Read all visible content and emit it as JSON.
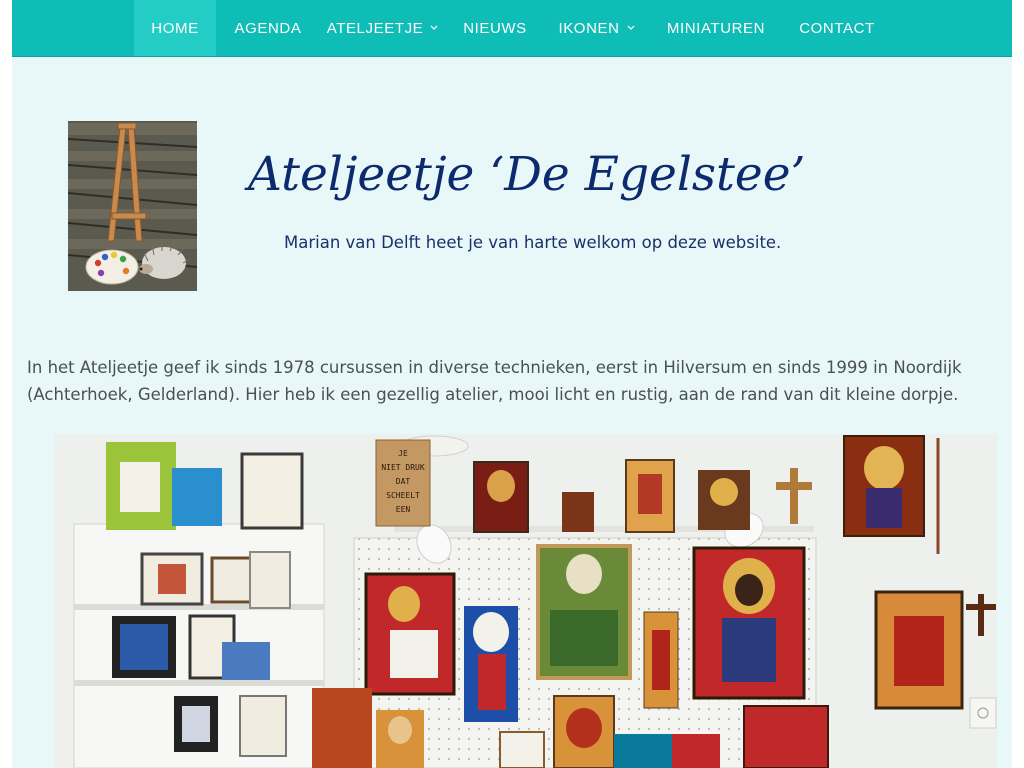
{
  "nav": {
    "items": [
      {
        "label": "HOME",
        "active": true,
        "has_dropdown": false
      },
      {
        "label": "AGENDA",
        "active": false,
        "has_dropdown": false
      },
      {
        "label": "ATELJEETJE",
        "active": false,
        "has_dropdown": true
      },
      {
        "label": "NIEUWS",
        "active": false,
        "has_dropdown": false
      },
      {
        "label": "IKONEN",
        "active": false,
        "has_dropdown": true
      },
      {
        "label": "MINIATUREN",
        "active": false,
        "has_dropdown": false
      },
      {
        "label": "CONTACT",
        "active": false,
        "has_dropdown": false
      }
    ]
  },
  "header": {
    "title": "Ateljeetje  ‘De Egelstee’",
    "tagline": "Marian van Delft heet je van harte welkom op deze website."
  },
  "intro": {
    "text": "In het Ateljeetje geef ik sinds 1978 cursussen in diverse technieken, eerst in Hilversum en sinds 1999 in Noordijk (Achterhoek, Gelderland). Hier heb ik een gezellig atelier, mooi licht en rustig, aan de rand van dit kleine dorpje."
  },
  "photo": {
    "sign_text": "JE NIET DRUK DAT SCHEELT EEN..."
  },
  "colors": {
    "nav_bg": "#0fbdb7",
    "nav_active": "#23ccc5",
    "page_bg": "#e8f8f8",
    "title": "#0d2a6e",
    "body_text": "#4a4f57"
  }
}
